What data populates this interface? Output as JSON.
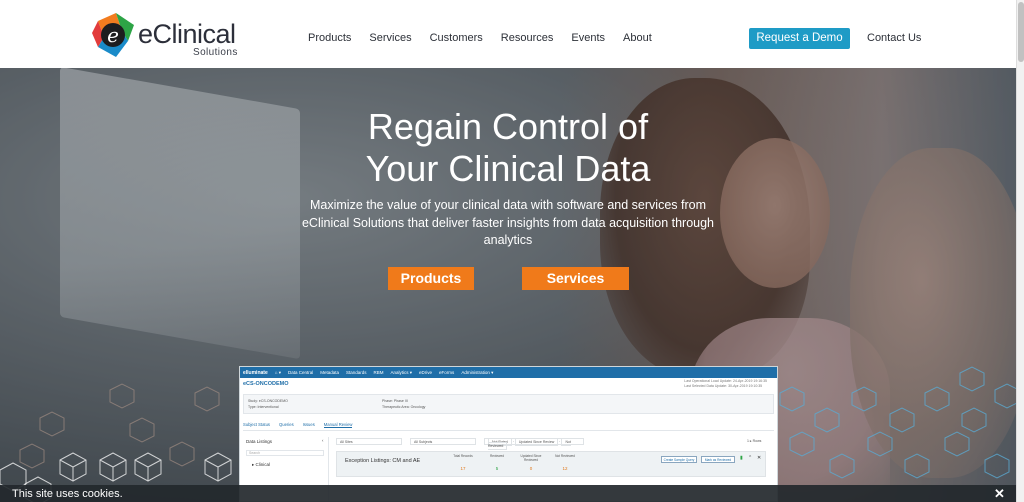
{
  "nav": {
    "logo_word": "eClinical",
    "logo_sub": "Solutions",
    "menu": [
      "Products",
      "Services",
      "Customers",
      "Resources",
      "Events",
      "About"
    ],
    "demo": "Request a Demo",
    "contact": "Contact Us"
  },
  "hero": {
    "title_line1": "Regain Control of",
    "title_line2": "Your Clinical Data",
    "subtitle": "Maximize the value of your clinical data with software and services from eClinical Solutions that deliver faster insights from data acquisition through analytics",
    "btn_products": "Products",
    "btn_services": "Services"
  },
  "app": {
    "brand": "elluminate",
    "menu": [
      "Data Central",
      "Metadata",
      "Standards",
      "RBM",
      "Analytics ▾",
      "eDrive",
      "eForms",
      "Administration ▾"
    ],
    "study_title": "eCS-ONCODEMO",
    "updated_1": "Last Operational Load Update: 24-Apr-2019 19:16:35",
    "updated_2": "Last Selected Data Update: 30-Apr-2019 19:10:35",
    "info_a_1": "Study: eCS-ONCODEMO",
    "info_a_2": "Type: Interventional",
    "info_b_1": "Phase: Phase III",
    "info_b_2": "Therapeutic Area: Oncology",
    "tabs": [
      "Subject Status",
      "Queries",
      "Issues",
      "Manual Review"
    ],
    "side_title": "Data Listings",
    "side_search": "Search",
    "side_item": "Clinical",
    "filters": [
      "All Sites",
      "All Subjects",
      "Not Rated",
      "Updated Since Review",
      "Not Reviewed"
    ],
    "paging": "1  ▸ Rows",
    "exc_title": "Exception Listings: CM and AE",
    "cols": [
      "Total Records",
      "Reviewed",
      "Updated Since Reviewed",
      "Not Reviewed"
    ],
    "nums": [
      "17",
      "5",
      "0",
      "12"
    ],
    "btn1": "Create Sample Query",
    "btn2": "Mark as Reviewed"
  },
  "cookie": {
    "text": "This site uses cookies.",
    "close": "✕"
  },
  "colors": {
    "accent_blue": "#1e9bc6",
    "accent_orange": "#f07a1a",
    "logo_orange": "#f27c1f",
    "logo_green": "#2da446",
    "logo_blue": "#1a8bc9"
  }
}
